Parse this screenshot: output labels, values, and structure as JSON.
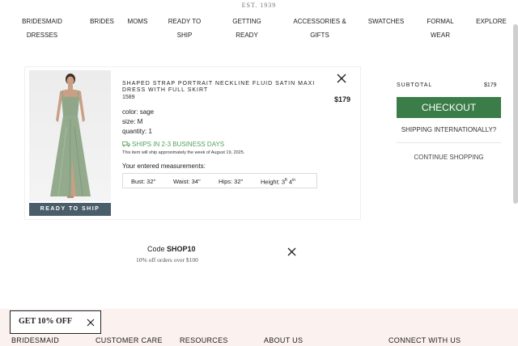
{
  "header": {
    "est": "EST. 1939",
    "nav": [
      {
        "label": "BRIDESMAID DRESSES"
      },
      {
        "label": "BRIDES"
      },
      {
        "label": "MOMS"
      },
      {
        "label": "READY TO SHIP"
      },
      {
        "label": "GETTING READY"
      },
      {
        "label": "ACCESSORIES & GIFTS"
      },
      {
        "label": "SWATCHES"
      },
      {
        "label": "FORMAL WEAR"
      },
      {
        "label": "EXPLORE"
      }
    ]
  },
  "cart_item": {
    "title": "SHAPED STRAP PORTRAIT NECKLINE FLUID SATIN MAXI DRESS WITH FULL SKIRT",
    "sku": "1589",
    "price": "$179",
    "color": "color: sage",
    "size": "size: M",
    "quantity": "quantity: 1",
    "ships": "SHIPS IN 2-3 BUSINESS DAYS",
    "ships_note": "This item will ship approximately the week of August 19, 2025.",
    "badge": "READY TO SHIP",
    "measurements_title": "Your entered measurements:",
    "measurements": {
      "bust": "Bust: 32\"",
      "waist": "Waist: 34\"",
      "hips": "Hips: 32\"",
      "height_prefix": "Height: 3",
      "height_ft_sup": "ft",
      "height_in": " 4",
      "height_in_sup": "in"
    },
    "product_color": "#8fa788"
  },
  "summary": {
    "subtotal_label": "SUBTOTAL",
    "subtotal_value": "$179",
    "checkout_label": "CHECKOUT",
    "ship_intl_label": "SHIPPING INTERNATIONALLY?",
    "continue_label": "CONTINUE SHOPPING",
    "checkout_color": "#3a7d48"
  },
  "promo": {
    "code_prefix": "Code ",
    "code": "SHOP10",
    "sub": "10% off orders over $100"
  },
  "footer": {
    "items": [
      {
        "label": "BRIDESMAID"
      },
      {
        "label": "CUSTOMER CARE"
      },
      {
        "label": "RESOURCES"
      },
      {
        "label": "ABOUT US"
      },
      {
        "label": "CONNECT WITH US"
      }
    ],
    "bg_color": "#fbf1ef"
  },
  "popup": {
    "label": "GET 10% OFF"
  }
}
